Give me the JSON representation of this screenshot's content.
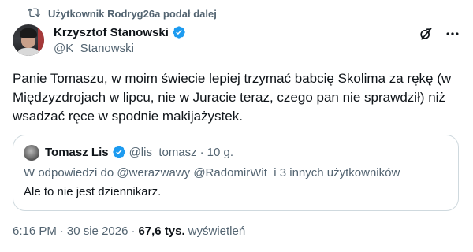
{
  "context": {
    "icon": "retweet-icon",
    "label": "Użytkownik Rodryg26a podał dalej"
  },
  "author": {
    "name": "Krzysztof Stanowski",
    "handle": "@K_Stanowski",
    "verified_color": "#1d9bf0"
  },
  "header_actions": [
    {
      "icon": "grok-icon"
    },
    {
      "icon": "more-icon"
    }
  ],
  "tweet": {
    "text": "Panie Tomaszu, w moim świecie lepiej trzymać babcię Skolima za rękę (w\nMiędzyzdrojach w lipcu, nie w Juracie teraz, czego pan nie sprawdził) niż\nwsadzać ręce w spodnie makijażystek."
  },
  "quote": {
    "name": "Tomasz Lis",
    "handle": "@lis_tomasz",
    "dot": "·",
    "time": "10 g.",
    "reply_prefix": "W odpowiedzi do ",
    "reply_mentions": "@werazwawy @RadomirWit",
    "reply_suffix": "  i 3 innych użytkowników",
    "text": "Ale to nie jest dziennikarz."
  },
  "footer": {
    "time": "6:16 PM",
    "dot1": "·",
    "date": "30 sie 2026",
    "dot2": "·",
    "views_count": "67,6 tys.",
    "views_label": "wyświetleń"
  }
}
